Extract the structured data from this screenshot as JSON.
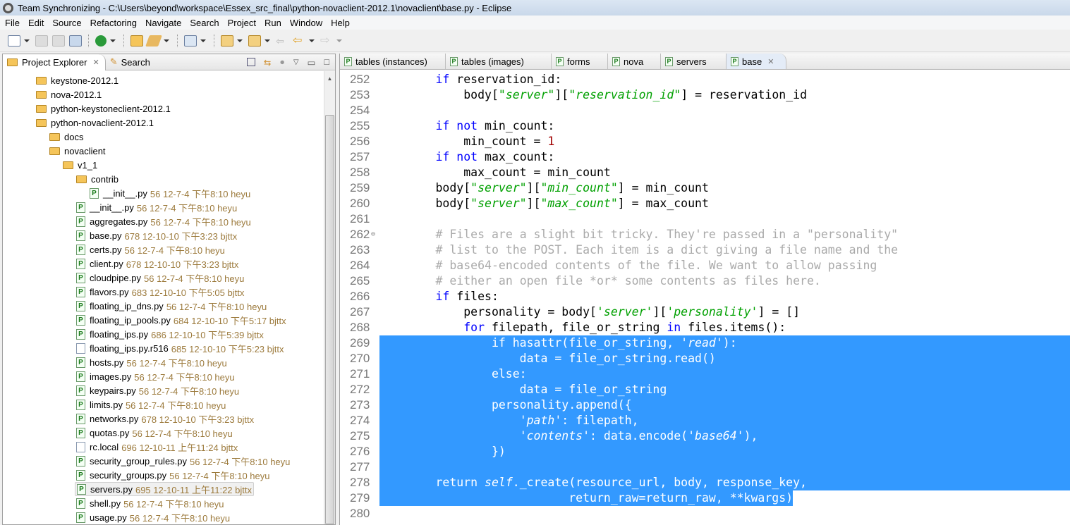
{
  "window": {
    "title": "Team Synchronizing - C:\\Users\\beyond\\workspace\\Essex_src_final\\python-novaclient-2012.1\\novaclient\\base.py - Eclipse"
  },
  "menu": [
    "File",
    "Edit",
    "Source",
    "Refactoring",
    "Navigate",
    "Search",
    "Project",
    "Run",
    "Window",
    "Help"
  ],
  "toolbar": {
    "icons": [
      "new-wizard-icon",
      "save-icon",
      "save-all-icon",
      "print-icon",
      "run-icon",
      "open-folder-icon",
      "search-icon",
      "team-sync-icon",
      "next-annotation-icon",
      "previous-annotation-icon",
      "last-edit-icon",
      "back-icon",
      "forward-icon"
    ]
  },
  "left_panel": {
    "tabs": [
      {
        "label": "Project Explorer",
        "active": true
      },
      {
        "label": "Search",
        "active": false
      }
    ],
    "tree": [
      {
        "indent": 0,
        "icon": "folder",
        "name": "keystone-2012.1"
      },
      {
        "indent": 0,
        "icon": "folder",
        "name": "nova-2012.1"
      },
      {
        "indent": 0,
        "icon": "folder",
        "name": "python-keystoneclient-2012.1"
      },
      {
        "indent": 0,
        "icon": "folder",
        "name": "python-novaclient-2012.1"
      },
      {
        "indent": 1,
        "icon": "folder",
        "name": "docs"
      },
      {
        "indent": 1,
        "icon": "folder",
        "name": "novaclient"
      },
      {
        "indent": 2,
        "icon": "folder",
        "name": "v1_1"
      },
      {
        "indent": 3,
        "icon": "folder",
        "name": "contrib"
      },
      {
        "indent": 4,
        "icon": "py",
        "name": "__init__.py",
        "meta": "56  12-7-4 下午8:10  heyu"
      },
      {
        "indent": 3,
        "icon": "py",
        "name": "__init__.py",
        "meta": "56  12-7-4 下午8:10  heyu"
      },
      {
        "indent": 3,
        "icon": "py",
        "name": "aggregates.py",
        "meta": "56  12-7-4 下午8:10  heyu"
      },
      {
        "indent": 3,
        "icon": "py",
        "name": "base.py",
        "meta": "678  12-10-10 下午3:23  bjttx"
      },
      {
        "indent": 3,
        "icon": "py",
        "name": "certs.py",
        "meta": "56  12-7-4 下午8:10  heyu"
      },
      {
        "indent": 3,
        "icon": "py",
        "name": "client.py",
        "meta": "678  12-10-10 下午3:23  bjttx"
      },
      {
        "indent": 3,
        "icon": "py",
        "name": "cloudpipe.py",
        "meta": "56  12-7-4 下午8:10  heyu"
      },
      {
        "indent": 3,
        "icon": "py",
        "name": "flavors.py",
        "meta": "683  12-10-10 下午5:05  bjttx"
      },
      {
        "indent": 3,
        "icon": "py",
        "name": "floating_ip_dns.py",
        "meta": "56  12-7-4 下午8:10  heyu"
      },
      {
        "indent": 3,
        "icon": "py",
        "name": "floating_ip_pools.py",
        "meta": "684  12-10-10 下午5:17  bjttx"
      },
      {
        "indent": 3,
        "icon": "py",
        "name": "floating_ips.py",
        "meta": "686  12-10-10 下午5:39  bjttx"
      },
      {
        "indent": 3,
        "icon": "txt",
        "name": "floating_ips.py.r516",
        "meta": "685  12-10-10 下午5:23  bjttx"
      },
      {
        "indent": 3,
        "icon": "py",
        "name": "hosts.py",
        "meta": "56  12-7-4 下午8:10  heyu"
      },
      {
        "indent": 3,
        "icon": "py",
        "name": "images.py",
        "meta": "56  12-7-4 下午8:10  heyu"
      },
      {
        "indent": 3,
        "icon": "py",
        "name": "keypairs.py",
        "meta": "56  12-7-4 下午8:10  heyu"
      },
      {
        "indent": 3,
        "icon": "py",
        "name": "limits.py",
        "meta": "56  12-7-4 下午8:10  heyu"
      },
      {
        "indent": 3,
        "icon": "py",
        "name": "networks.py",
        "meta": "678  12-10-10 下午3:23  bjttx"
      },
      {
        "indent": 3,
        "icon": "py",
        "name": "quotas.py",
        "meta": "56  12-7-4 下午8:10  heyu"
      },
      {
        "indent": 3,
        "icon": "txt",
        "name": "rc.local",
        "meta": "696  12-10-11 上午11:24  bjttx"
      },
      {
        "indent": 3,
        "icon": "py",
        "name": "security_group_rules.py",
        "meta": "56  12-7-4 下午8:10  heyu"
      },
      {
        "indent": 3,
        "icon": "py",
        "name": "security_groups.py",
        "meta": "56  12-7-4 下午8:10  heyu"
      },
      {
        "indent": 3,
        "icon": "py",
        "name": "servers.py",
        "meta": "695  12-10-11 上午11:22  bjttx",
        "selected": true
      },
      {
        "indent": 3,
        "icon": "py",
        "name": "shell.py",
        "meta": "56  12-7-4 下午8:10  heyu"
      },
      {
        "indent": 3,
        "icon": "py",
        "name": "usage.py",
        "meta": "56  12-7-4 下午8:10  heyu"
      }
    ]
  },
  "editor": {
    "tabs": [
      {
        "label": "tables (instances)"
      },
      {
        "label": "tables (images)"
      },
      {
        "label": "forms"
      },
      {
        "label": "nova"
      },
      {
        "label": "servers"
      },
      {
        "label": "base",
        "active": true
      }
    ],
    "colors": {
      "keyword": "#0000ff",
      "string": "#00a000",
      "comment": "#aaaaaa",
      "number": "#a00000",
      "selection": "#3399ff"
    },
    "selection": {
      "from_line": 269,
      "to_line": 279
    },
    "lines": [
      {
        "n": "252",
        "t": [
          [
            "p",
            "        "
          ],
          [
            "kw",
            "if"
          ],
          [
            "p",
            " reservation_id:"
          ]
        ]
      },
      {
        "n": "253",
        "t": [
          [
            "p",
            "            body["
          ],
          [
            "str",
            "\"server\""
          ],
          [
            "p",
            "]["
          ],
          [
            "str",
            "\"reservation_id\""
          ],
          [
            "p",
            "] = reservation_id"
          ]
        ]
      },
      {
        "n": "254",
        "t": []
      },
      {
        "n": "255",
        "t": [
          [
            "p",
            "        "
          ],
          [
            "kw",
            "if not"
          ],
          [
            "p",
            " min_count:"
          ]
        ]
      },
      {
        "n": "256",
        "t": [
          [
            "p",
            "            min_count = "
          ],
          [
            "num",
            "1"
          ]
        ]
      },
      {
        "n": "257",
        "t": [
          [
            "p",
            "        "
          ],
          [
            "kw",
            "if not"
          ],
          [
            "p",
            " max_count:"
          ]
        ]
      },
      {
        "n": "258",
        "t": [
          [
            "p",
            "            max_count = min_count"
          ]
        ]
      },
      {
        "n": "259",
        "t": [
          [
            "p",
            "        body["
          ],
          [
            "str",
            "\"server\""
          ],
          [
            "p",
            "]["
          ],
          [
            "str",
            "\"min_count\""
          ],
          [
            "p",
            "] = min_count"
          ]
        ]
      },
      {
        "n": "260",
        "t": [
          [
            "p",
            "        body["
          ],
          [
            "str",
            "\"server\""
          ],
          [
            "p",
            "]["
          ],
          [
            "str",
            "\"max_count\""
          ],
          [
            "p",
            "] = max_count"
          ]
        ]
      },
      {
        "n": "261",
        "t": []
      },
      {
        "n": "262",
        "fold": true,
        "t": [
          [
            "p",
            "        "
          ],
          [
            "cm",
            "# Files are a slight bit tricky. They're passed in a \"personality\""
          ]
        ]
      },
      {
        "n": "263",
        "t": [
          [
            "p",
            "        "
          ],
          [
            "cm",
            "# list to the POST. Each item is a dict giving a file name and the"
          ]
        ]
      },
      {
        "n": "264",
        "t": [
          [
            "p",
            "        "
          ],
          [
            "cm",
            "# base64-encoded contents of the file. We want to allow passing"
          ]
        ]
      },
      {
        "n": "265",
        "t": [
          [
            "p",
            "        "
          ],
          [
            "cm",
            "# either an open file *or* some contents as files here."
          ]
        ]
      },
      {
        "n": "266",
        "t": [
          [
            "p",
            "        "
          ],
          [
            "kw",
            "if"
          ],
          [
            "p",
            " files:"
          ]
        ]
      },
      {
        "n": "267",
        "t": [
          [
            "p",
            "            personality = body["
          ],
          [
            "str",
            "'server'"
          ],
          [
            "p",
            "]["
          ],
          [
            "str",
            "'personality'"
          ],
          [
            "p",
            "] = []"
          ]
        ]
      },
      {
        "n": "268",
        "t": [
          [
            "p",
            "            "
          ],
          [
            "kw",
            "for"
          ],
          [
            "p",
            " filepath, file_or_string "
          ],
          [
            "kw",
            "in"
          ],
          [
            "p",
            " files.items():"
          ]
        ]
      },
      {
        "n": "269",
        "t": [
          [
            "p",
            "                if hasattr(file_or_string, "
          ],
          [
            "str",
            "'read'"
          ],
          [
            "p",
            "):"
          ]
        ]
      },
      {
        "n": "270",
        "t": [
          [
            "p",
            "                    data = file_or_string.read()"
          ]
        ]
      },
      {
        "n": "271",
        "t": [
          [
            "p",
            "                else:"
          ]
        ]
      },
      {
        "n": "272",
        "t": [
          [
            "p",
            "                    data = file_or_string"
          ]
        ]
      },
      {
        "n": "273",
        "t": [
          [
            "p",
            "                personality.append({"
          ]
        ]
      },
      {
        "n": "274",
        "t": [
          [
            "p",
            "                    "
          ],
          [
            "str",
            "'path'"
          ],
          [
            "p",
            ": filepath,"
          ]
        ]
      },
      {
        "n": "275",
        "t": [
          [
            "p",
            "                    "
          ],
          [
            "str",
            "'contents'"
          ],
          [
            "p",
            ": data.encode("
          ],
          [
            "str",
            "'base64'"
          ],
          [
            "p",
            "),"
          ]
        ]
      },
      {
        "n": "276",
        "t": [
          [
            "p",
            "                })"
          ]
        ]
      },
      {
        "n": "277",
        "t": []
      },
      {
        "n": "278",
        "t": [
          [
            "p",
            "        return "
          ],
          [
            "it",
            "self"
          ],
          [
            "p",
            "._create(resource_url, body, response_key,"
          ]
        ]
      },
      {
        "n": "279",
        "t": [
          [
            "p",
            "                           return_raw=return_raw, **kwargs)"
          ]
        ]
      },
      {
        "n": "280",
        "t": []
      }
    ]
  }
}
